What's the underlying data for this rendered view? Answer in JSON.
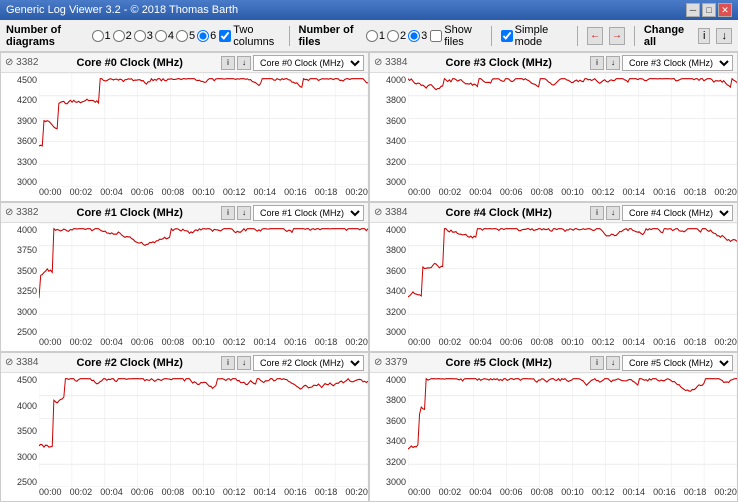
{
  "titleBar": {
    "title": "Generic Log Viewer 3.2 - © 2018 Thomas Barth",
    "controls": [
      "minimize",
      "maximize",
      "close"
    ]
  },
  "toolbar": {
    "diagrams_label": "Number of diagrams",
    "diagrams_options": [
      "1",
      "2",
      "3",
      "4",
      "5",
      "6"
    ],
    "two_columns_label": "Two columns",
    "files_label": "Number of files",
    "files_options": [
      "1",
      "2",
      "3"
    ],
    "show_files_label": "Show files",
    "simple_mode_label": "Simple mode",
    "change_all_label": "Change all",
    "info_btn": "i",
    "download_btn": "↓"
  },
  "charts": [
    {
      "id": "chart0",
      "value": "3382",
      "title": "Core #0 Clock (MHz)",
      "dropdown": "Core #0 Clock (MHz)",
      "yLabels": [
        "4500",
        "4200",
        "3900",
        "3600",
        "3300",
        "3000"
      ],
      "xLabels": [
        "00:00",
        "00:02",
        "00:04",
        "00:06",
        "00:08",
        "00:10",
        "00:12",
        "00:14",
        "00:16",
        "00:18",
        "00:20"
      ],
      "color": "#cc0000"
    },
    {
      "id": "chart1",
      "value": "3384",
      "title": "Core #3 Clock (MHz)",
      "dropdown": "Core #3 Clock (MHz)",
      "yLabels": [
        "4000",
        "3800",
        "3600",
        "3400",
        "3200",
        "3000"
      ],
      "xLabels": [
        "00:00",
        "00:02",
        "00:04",
        "00:06",
        "00:08",
        "00:10",
        "00:12",
        "00:14",
        "00:16",
        "00:18",
        "00:20"
      ],
      "color": "#cc0000"
    },
    {
      "id": "chart2",
      "value": "3382",
      "title": "Core #1 Clock (MHz)",
      "dropdown": "Core #1 Clock (MHz)",
      "yLabels": [
        "4000",
        "3750",
        "3500",
        "3250",
        "3000",
        "2500"
      ],
      "xLabels": [
        "00:00",
        "00:02",
        "00:04",
        "00:06",
        "00:08",
        "00:10",
        "00:12",
        "00:14",
        "00:16",
        "00:18",
        "00:20"
      ],
      "color": "#cc0000"
    },
    {
      "id": "chart3",
      "value": "3384",
      "title": "Core #4 Clock (MHz)",
      "dropdown": "Core #4 Clock (MHz)",
      "yLabels": [
        "4000",
        "3800",
        "3600",
        "3400",
        "3200",
        "3000"
      ],
      "xLabels": [
        "00:00",
        "00:02",
        "00:04",
        "00:06",
        "00:08",
        "00:10",
        "00:12",
        "00:14",
        "00:16",
        "00:18",
        "00:20"
      ],
      "color": "#cc0000"
    },
    {
      "id": "chart4",
      "value": "3384",
      "title": "Core #2 Clock (MHz)",
      "dropdown": "Core #2 Clock (MHz)",
      "yLabels": [
        "4500",
        "4000",
        "3500",
        "3000",
        "2500"
      ],
      "xLabels": [
        "00:00",
        "00:02",
        "00:04",
        "00:06",
        "00:08",
        "00:10",
        "00:12",
        "00:14",
        "00:16",
        "00:18",
        "00:20"
      ],
      "color": "#cc0000"
    },
    {
      "id": "chart5",
      "value": "3379",
      "title": "Core #5 Clock (MHz)",
      "dropdown": "Core #5 Clock (MHz)",
      "yLabels": [
        "4000",
        "3800",
        "3600",
        "3400",
        "3200",
        "3000"
      ],
      "xLabels": [
        "00:00",
        "00:02",
        "00:04",
        "00:06",
        "00:08",
        "00:10",
        "00:12",
        "00:14",
        "00:16",
        "00:18",
        "00:20"
      ],
      "color": "#cc0000"
    }
  ]
}
